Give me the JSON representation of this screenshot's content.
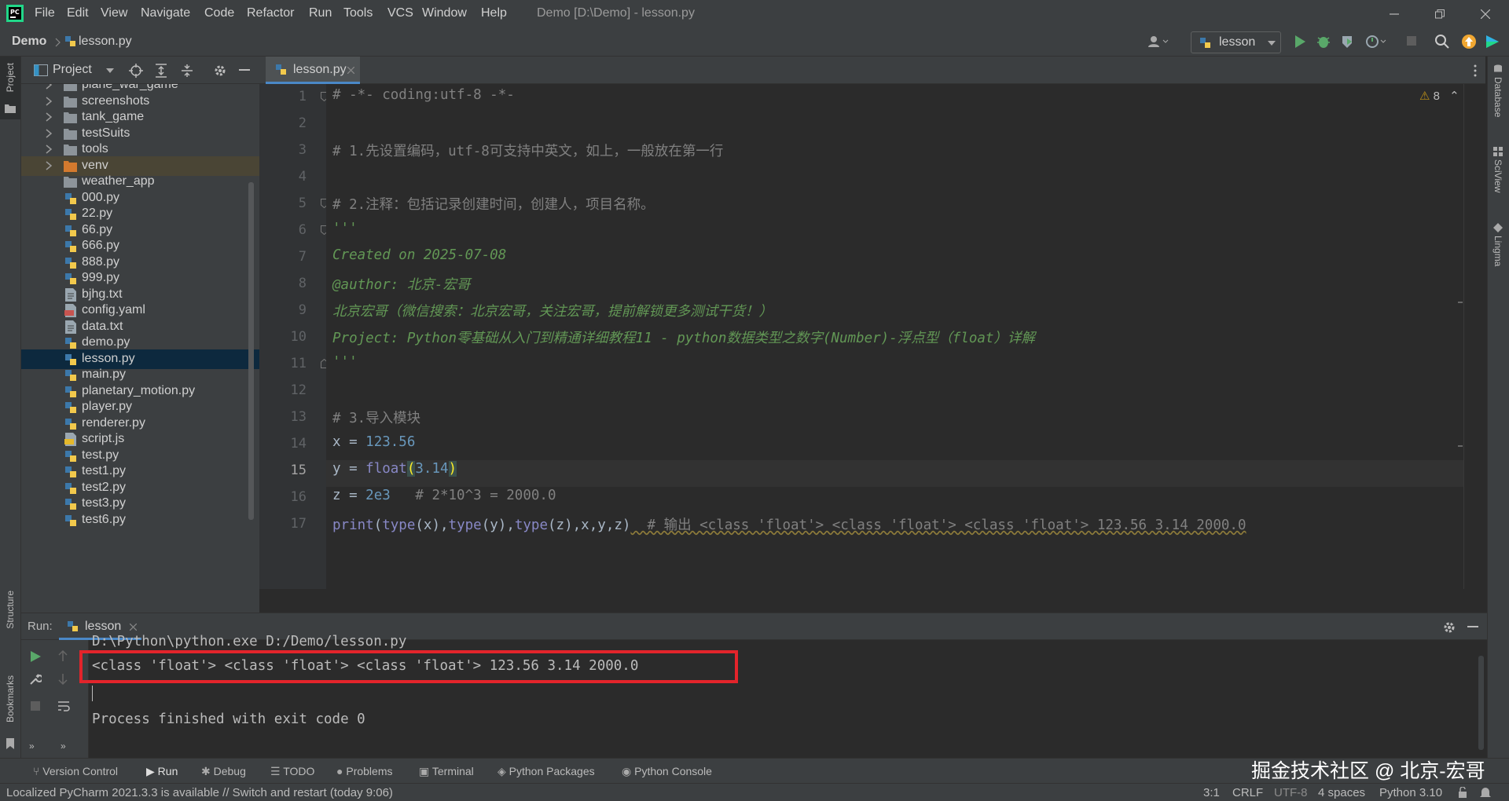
{
  "menu": [
    "File",
    "Edit",
    "View",
    "Navigate",
    "Code",
    "Refactor",
    "Run",
    "Tools",
    "VCS",
    "Window",
    "Help"
  ],
  "window_title": "Demo [D:\\Demo] - lesson.py",
  "breadcrumb": {
    "project": "Demo",
    "file": "lesson.py"
  },
  "run_config": "lesson",
  "left_stripe": {
    "project": "Project",
    "structure": "Structure",
    "bookmarks": "Bookmarks"
  },
  "right_stripe": {
    "database": "Database",
    "sciview": "SciView",
    "lingma": "Lingma"
  },
  "project_panel": {
    "title": "Project",
    "items": [
      {
        "label": "plane_war_game",
        "type": "folder",
        "expandable": true
      },
      {
        "label": "screenshots",
        "type": "folder",
        "expandable": true
      },
      {
        "label": "tank_game",
        "type": "folder",
        "expandable": true
      },
      {
        "label": "testSuits",
        "type": "folder",
        "expandable": true
      },
      {
        "label": "tools",
        "type": "folder",
        "expandable": true
      },
      {
        "label": "venv",
        "type": "venv",
        "expandable": true
      },
      {
        "label": "weather_app",
        "type": "folder",
        "expandable": false
      },
      {
        "label": "000.py",
        "type": "py"
      },
      {
        "label": "22.py",
        "type": "py"
      },
      {
        "label": "66.py",
        "type": "py"
      },
      {
        "label": "666.py",
        "type": "py"
      },
      {
        "label": "888.py",
        "type": "py"
      },
      {
        "label": "999.py",
        "type": "py"
      },
      {
        "label": "bjhg.txt",
        "type": "txt"
      },
      {
        "label": "config.yaml",
        "type": "yaml"
      },
      {
        "label": "data.txt",
        "type": "txt"
      },
      {
        "label": "demo.py",
        "type": "py"
      },
      {
        "label": "lesson.py",
        "type": "py",
        "selected": true
      },
      {
        "label": "main.py",
        "type": "py"
      },
      {
        "label": "planetary_motion.py",
        "type": "py"
      },
      {
        "label": "player.py",
        "type": "py"
      },
      {
        "label": "renderer.py",
        "type": "py"
      },
      {
        "label": "script.js",
        "type": "js"
      },
      {
        "label": "test.py",
        "type": "py"
      },
      {
        "label": "test1.py",
        "type": "py"
      },
      {
        "label": "test2.py",
        "type": "py"
      },
      {
        "label": "test3.py",
        "type": "py"
      },
      {
        "label": "test6.py",
        "type": "py"
      }
    ]
  },
  "editor": {
    "tab": "lesson.py",
    "warnings": "8",
    "current_line": 15,
    "line_numbers": [
      "1",
      "2",
      "3",
      "4",
      "5",
      "6",
      "7",
      "8",
      "9",
      "10",
      "11",
      "12",
      "13",
      "14",
      "15",
      "16",
      "17"
    ],
    "lines": {
      "l1": "# -*- coding:utf-8 -*-",
      "l3": "# 1.先设置编码，utf-8可支持中英文，如上，一般放在第一行",
      "l5": "# 2.注释：包括记录创建时间，创建人，项目名称。",
      "l6": "'''",
      "l7": "Created on 2025-07-08",
      "l8": "@author: 北京-宏哥",
      "l9": "北京宏哥（微信搜索：北京宏哥，关注宏哥，提前解锁更多测试干货！）",
      "l10": "Project: Python零基础从入门到精通详细教程11 - python数据类型之数字(Number)-浮点型（float）详解",
      "l11": "'''",
      "l13": "# 3.导入模块",
      "l14_a": "x = ",
      "l14_b": "123.56",
      "l15_a": "y = ",
      "l15_b": "float",
      "l15_c": "(",
      "l15_d": "3.14",
      "l15_e": ")",
      "l16_a": "z = ",
      "l16_b": "2e3",
      "l16_c": "   # 2*10^3 = 2000.0",
      "l17_print": "print",
      "l17_p1": "(",
      "l17_t1": "type",
      "l17_a1": "(x)",
      "l17_c1": ",",
      "l17_t2": "type",
      "l17_a2": "(y)",
      "l17_c2": ",",
      "l17_t3": "type",
      "l17_a3": "(z)",
      "l17_c3": ",",
      "l17_x": "x",
      "l17_c4": ",",
      "l17_y": "y",
      "l17_c5": ",",
      "l17_z": "z)",
      "l17_comment": "  # 输出 <class 'float'> <class 'float'> <class 'float'> 123.56 3.14 2000.0"
    }
  },
  "run": {
    "label": "Run:",
    "tab": "lesson",
    "command": "D:\\Python\\python.exe D:/Demo/lesson.py",
    "output": "<class 'float'> <class 'float'> <class 'float'> 123.56 3.14 2000.0",
    "exit": "Process finished with exit code 0"
  },
  "bottom_tools": [
    "Version Control",
    "Run",
    "Debug",
    "TODO",
    "Problems",
    "Terminal",
    "Python Packages",
    "Python Console"
  ],
  "status": {
    "message": "Localized PyCharm 2021.3.3 is available // Switch and restart (today 9:06)",
    "position": "3:1",
    "line_sep": "CRLF",
    "encoding": "UTF-8",
    "indent": "4 spaces",
    "interpreter": "Python 3.10"
  },
  "watermark": "掘金技术社区 @ 北京-宏哥",
  "colors": {
    "accent": "#4a88c7",
    "highlight_box": "#e3242b",
    "comment": "#808080",
    "docstring": "#629755",
    "number": "#6897bb",
    "builtin": "#8888c6"
  }
}
